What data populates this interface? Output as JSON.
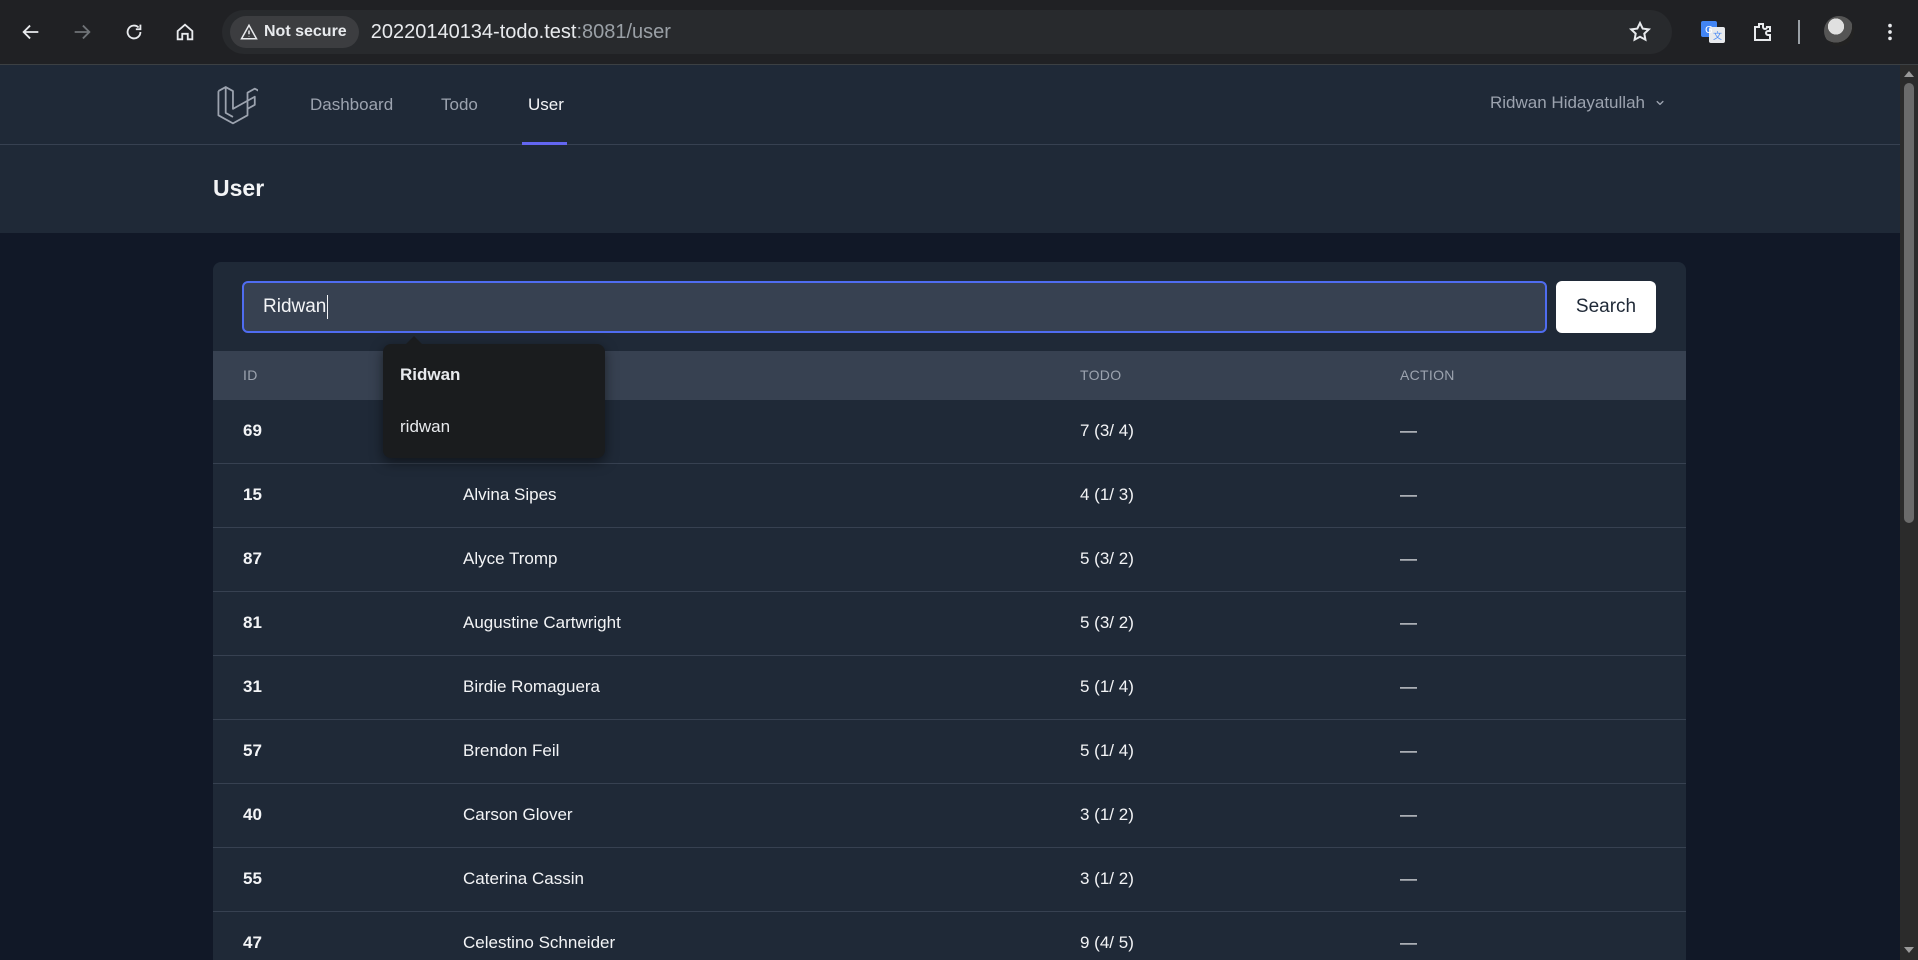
{
  "browser": {
    "security_label": "Not secure",
    "url_host": "20220140134-todo.test",
    "url_rest": ":8081/user"
  },
  "nav": {
    "links": [
      "Dashboard",
      "Todo",
      "User"
    ],
    "active": "User",
    "user_name": "Ridwan Hidayatullah"
  },
  "page": {
    "title": "User"
  },
  "search": {
    "value": "Ridwan",
    "button_label": "Search",
    "suggestions": [
      "Ridwan",
      "ridwan"
    ]
  },
  "table": {
    "columns": [
      "ID",
      "TODO",
      "ACTION"
    ],
    "rows": [
      {
        "id": "69",
        "name": "",
        "todo": "7 (3/ 4)",
        "action": "—"
      },
      {
        "id": "15",
        "name": "Alvina Sipes",
        "todo": "4 (1/ 3)",
        "action": "—"
      },
      {
        "id": "87",
        "name": "Alyce Tromp",
        "todo": "5 (3/ 2)",
        "action": "—"
      },
      {
        "id": "81",
        "name": "Augustine Cartwright",
        "todo": "5 (3/ 2)",
        "action": "—"
      },
      {
        "id": "31",
        "name": "Birdie Romaguera",
        "todo": "5 (1/ 4)",
        "action": "—"
      },
      {
        "id": "57",
        "name": "Brendon Feil",
        "todo": "5 (1/ 4)",
        "action": "—"
      },
      {
        "id": "40",
        "name": "Carson Glover",
        "todo": "3 (1/ 2)",
        "action": "—"
      },
      {
        "id": "55",
        "name": "Caterina Cassin",
        "todo": "3 (1/ 2)",
        "action": "—"
      },
      {
        "id": "47",
        "name": "Celestino Schneider",
        "todo": "9 (4/ 5)",
        "action": "—"
      }
    ]
  },
  "colors": {
    "accent": "#6366f1",
    "focus_ring": "#4f6cf0",
    "surface": "#1f2937",
    "background": "#111827"
  }
}
